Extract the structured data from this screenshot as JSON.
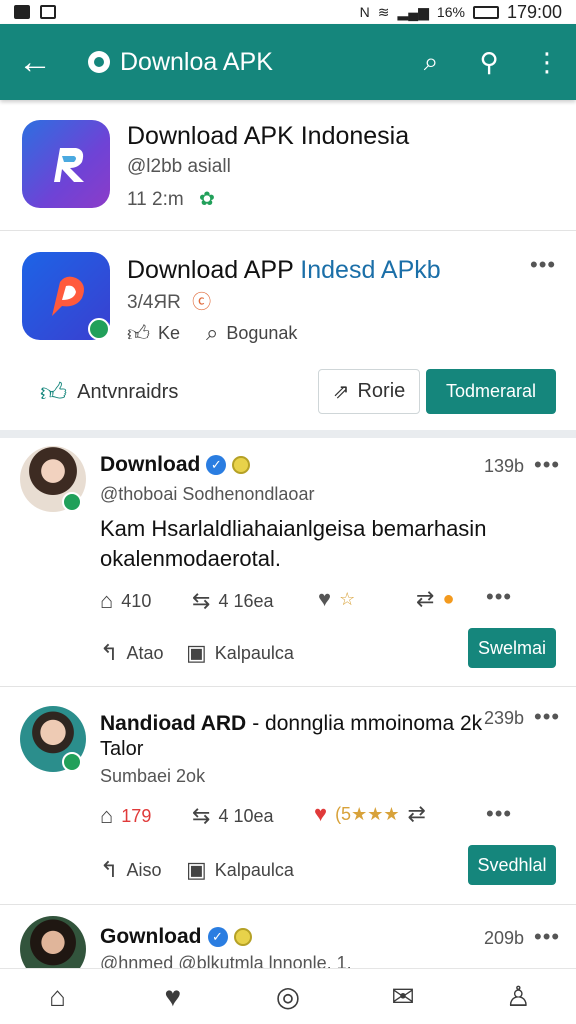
{
  "status": {
    "percent": "16%",
    "time": "179:00"
  },
  "appbar": {
    "title": "Downloa APK"
  },
  "apps": [
    {
      "title": "Download APK Indonesia",
      "handle": "@l2bb asiall",
      "meta": "11 2:m"
    },
    {
      "title_main": "Download APP ",
      "title_accent": "Indesd APkb",
      "meta": "3/4ЯR",
      "stat1": "Ke",
      "stat2": "Bogunak"
    }
  ],
  "actions": {
    "left": "Antvnraidrs",
    "outline": "Rorie",
    "solid": "Todmeraral"
  },
  "posts": [
    {
      "name": "Download",
      "handle": "@thoboai Sodhenondlaoar",
      "time": "139b",
      "text": "Kam Hsarlaldliahaianlgeisa bemarhasin okalenmodaerotal.",
      "reply": "410",
      "retweet": "4 16ea",
      "secondary_a": "Atao",
      "secondary_b": "Kalpaulca",
      "button": "Swelmai"
    },
    {
      "name": "Nandioad ARD",
      "name_rest": "- donnglia mmoinoma 2k",
      "line2": "Talor",
      "handle": "Sumbaei 2ok",
      "time": "239b",
      "reply": "179",
      "retweet": "4 10ea",
      "rating": "(5★★★",
      "secondary_a": "Aiso",
      "secondary_b": "Kalpaulca",
      "button": "Svedhlal"
    },
    {
      "name": "Gownload",
      "handle": "@hnmed @blkutmla lnnonle, 1.",
      "time": "209b"
    }
  ]
}
